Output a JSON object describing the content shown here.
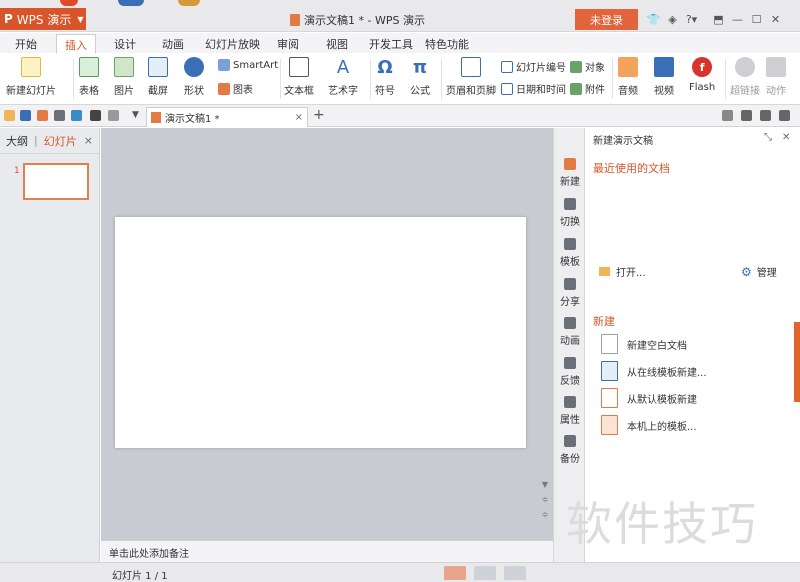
{
  "app": {
    "name": "WPS 演示",
    "window_title": "演示文稿1 * - WPS 演示",
    "login": "未登录",
    "window_controls": [
      "shirt-icon",
      "chat-icon",
      "help-icon",
      "restore-icon",
      "minimize-icon",
      "maximize-icon",
      "close-icon"
    ]
  },
  "menu_tabs": [
    "开始",
    "插入",
    "设计",
    "动画",
    "幻灯片放映",
    "审阅",
    "视图",
    "开发工具",
    "特色功能"
  ],
  "ribbon": {
    "new_slide": "新建幻灯片",
    "table": "表格",
    "picture": "图片",
    "screenshot": "截屏",
    "shape": "形状",
    "smartart": "SmartArt",
    "chart": "图表",
    "textbox": "文本框",
    "wordart": "艺术字",
    "symbol": "符号",
    "formula": "公式",
    "symbol_glyph": "Ω",
    "formula_glyph": "π",
    "wordart_glyph": "A",
    "header_footer": "页眉和页脚",
    "slide_number": "幻灯片编号",
    "object": "对象",
    "datetime": "日期和时间",
    "attachment": "附件",
    "audio": "音频",
    "video": "视频",
    "flash": "Flash",
    "hyperlink": "超链接",
    "action": "动作"
  },
  "doc_tab": {
    "name": "演示文稿1 *",
    "close": "×",
    "new": "+"
  },
  "left_panel": {
    "tab_outline": "大纲",
    "tab_slides": "幻灯片",
    "close": "×",
    "slide_number": "1"
  },
  "notes_placeholder": "单击此处添加备注",
  "sidebar": [
    "新建",
    "切换",
    "模板",
    "分享",
    "动画",
    "反馈",
    "属性",
    "备份"
  ],
  "task_pane": {
    "header": "新建演示文稿",
    "recent": "最近使用的文档",
    "open": "打开...",
    "manage": "管理",
    "new_heading": "新建",
    "items": [
      "新建空白文档",
      "从在线模板新建...",
      "从默认模板新建",
      "本机上的模板..."
    ]
  },
  "watermark": "软件技巧",
  "status": {
    "page": "幻灯片 1 / 1"
  },
  "colors": {
    "accent": "#d8552a",
    "login": "#e1643d",
    "canvas_bg": "#c9cbd2"
  }
}
